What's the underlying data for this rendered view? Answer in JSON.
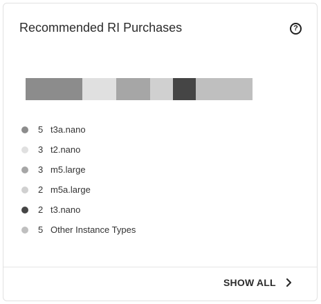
{
  "card": {
    "title": "Recommended RI Purchases",
    "help_icon": "question-circle-icon",
    "help_glyph": "?"
  },
  "chart_data": {
    "type": "bar",
    "stacked": true,
    "categories": [
      "t3a.nano",
      "t2.nano",
      "m5.large",
      "m5a.large",
      "t3.nano",
      "Other Instance Types"
    ],
    "values": [
      5,
      3,
      3,
      2,
      2,
      5
    ],
    "colors": [
      "#8c8c8c",
      "#e0e0e0",
      "#a6a6a6",
      "#d0d0d0",
      "#454545",
      "#bfbfbf"
    ]
  },
  "legend": [
    {
      "count": "5",
      "label": "t3a.nano"
    },
    {
      "count": "3",
      "label": "t2.nano"
    },
    {
      "count": "3",
      "label": "m5.large"
    },
    {
      "count": "2",
      "label": "m5a.large"
    },
    {
      "count": "2",
      "label": "t3.nano"
    },
    {
      "count": "5",
      "label": "Other Instance Types"
    }
  ],
  "footer": {
    "show_all_label": "SHOW ALL",
    "chevron_icon": "chevron-right-icon"
  }
}
